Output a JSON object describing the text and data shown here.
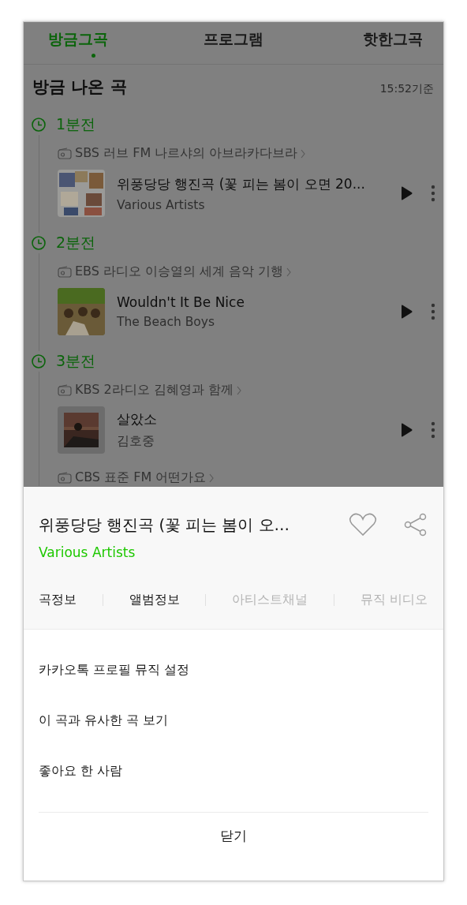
{
  "tabs": [
    {
      "label": "방금그곡",
      "selected": true
    },
    {
      "label": "프로그램",
      "selected": false
    },
    {
      "label": "핫한그곡",
      "selected": false
    }
  ],
  "section": {
    "title": "방금 나온 곡",
    "updated": "15:52기준"
  },
  "history": [
    {
      "time": "1분전",
      "program": "SBS 러브 FM 나르샤의 아브라카다브라",
      "track": {
        "title": "위풍당당 행진곡 (꽃 피는 봄이 오면 20...",
        "artist": "Various Artists"
      }
    },
    {
      "time": "2분전",
      "program": "EBS 라디오 이승열의 세계 음악 기행",
      "track": {
        "title": "Wouldn't It Be Nice",
        "artist": "The Beach Boys"
      }
    },
    {
      "time": "3분전",
      "program": "KBS 2라디오 김혜영과 함께",
      "track": {
        "title": "살았소",
        "artist": "김호중"
      }
    },
    {
      "program": "CBS 표준 FM 어떤가요"
    }
  ],
  "sheet": {
    "title": "위풍당당 행진곡 (꽃 피는 봄이 오…",
    "artist": "Various Artists",
    "info_tabs": [
      {
        "label": "곡정보",
        "disabled": false
      },
      {
        "label": "앨범정보",
        "disabled": false
      },
      {
        "label": "아티스트채널",
        "disabled": true
      },
      {
        "label": "뮤직 비디오",
        "disabled": true
      }
    ],
    "menu": [
      "카카오톡 프로필 뮤직 설정",
      "이 곡과 유사한 곡 보기",
      "좋아요 한 사람"
    ],
    "close": "닫기"
  }
}
